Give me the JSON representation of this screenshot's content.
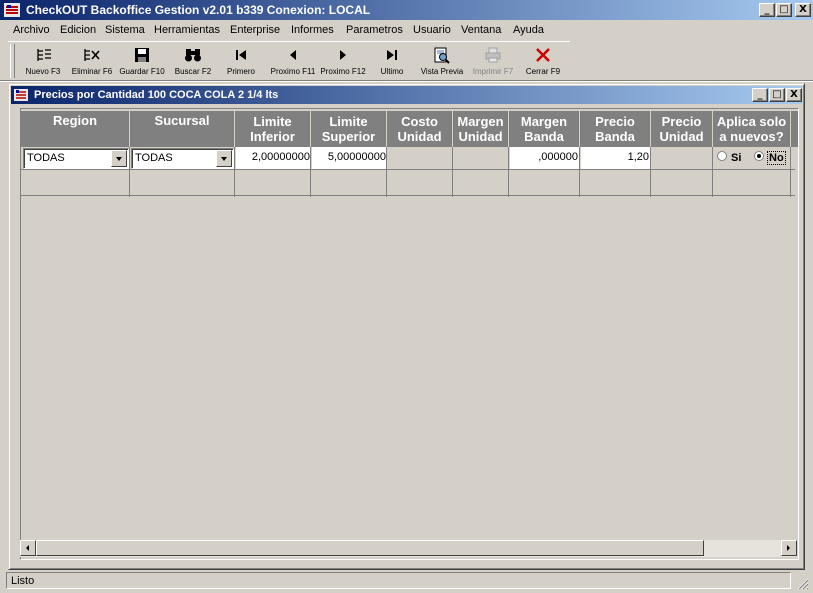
{
  "app": {
    "title": "CheckOUT Backoffice Gestion v2.01 b339 Conexion: LOCAL",
    "window_buttons": [
      "_",
      "□",
      "X"
    ]
  },
  "menu": [
    "Archivo",
    "Edicion",
    "Sistema",
    "Herramientas",
    "Enterprise",
    "Informes",
    "Parametros",
    "Usuario",
    "Ventana",
    "Ayuda"
  ],
  "toolbar": [
    {
      "label": "Nuevo F3",
      "icon": "new-list-icon",
      "enabled": true
    },
    {
      "label": "Eliminar F6",
      "icon": "delete-list-icon",
      "enabled": true
    },
    {
      "label": "Guardar F10",
      "icon": "floppy-disk-icon",
      "enabled": true
    },
    {
      "label": "Buscar F2",
      "icon": "binoculars-icon",
      "enabled": true
    },
    {
      "label": "Primero",
      "icon": "first-record-icon",
      "enabled": true
    },
    {
      "label": "Proximo F11",
      "icon": "previous-record-icon",
      "enabled": true
    },
    {
      "label": "Proximo F12",
      "icon": "next-record-icon",
      "enabled": true
    },
    {
      "label": "Ultimo",
      "icon": "last-record-icon",
      "enabled": true
    },
    {
      "label": "Vista Previa",
      "icon": "print-preview-icon",
      "enabled": true
    },
    {
      "label": "Imprimir F7",
      "icon": "printer-icon",
      "enabled": false
    },
    {
      "label": "Cerrar F9",
      "icon": "close-x-icon",
      "enabled": true
    }
  ],
  "child_window": {
    "title": "Precios por Cantidad 100 COCA COLA 2 1/4 lts",
    "window_buttons": [
      "_",
      "□",
      "X"
    ]
  },
  "grid": {
    "columns": [
      {
        "line1": "Region",
        "line2": ""
      },
      {
        "line1": "Sucursal",
        "line2": ""
      },
      {
        "line1": "Limite",
        "line2": "Inferior"
      },
      {
        "line1": "Limite",
        "line2": "Superior"
      },
      {
        "line1": "Costo",
        "line2": "Unidad"
      },
      {
        "line1": "Margen",
        "line2": "Unidad"
      },
      {
        "line1": "Margen",
        "line2": "Banda"
      },
      {
        "line1": "Precio",
        "line2": "Banda"
      },
      {
        "line1": "Precio",
        "line2": "Unidad"
      },
      {
        "line1": "Aplica solo",
        "line2": "a nuevos?"
      }
    ],
    "row": {
      "region": "TODAS",
      "sucursal": "TODAS",
      "limite_inferior": "2,00000000",
      "limite_superior": "5,00000000",
      "costo_unidad": "",
      "margen_unidad": "",
      "margen_banda": ",000000",
      "precio_banda": "1,20",
      "precio_unidad": "",
      "aplica_si_label": "Si",
      "aplica_no_label": "No",
      "aplica_selected": "No"
    }
  },
  "status": {
    "text": "Listo"
  },
  "colors": {
    "title_start": "#0a246a",
    "title_end": "#a6caf0",
    "face": "#d4d0c8",
    "header_bg": "#808080",
    "close_red": "#cc0000"
  }
}
